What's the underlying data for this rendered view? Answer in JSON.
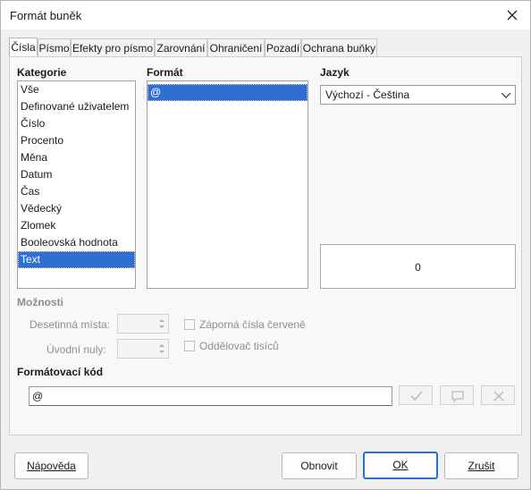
{
  "window": {
    "title": "Formát buněk"
  },
  "tabs": [
    {
      "label": "Čísla",
      "active": true
    },
    {
      "label": "Písmo"
    },
    {
      "label": "Efekty pro písmo"
    },
    {
      "label": "Zarovnání"
    },
    {
      "label": "Ohraničení"
    },
    {
      "label": "Pozadí"
    },
    {
      "label": "Ochrana buňky"
    }
  ],
  "category": {
    "label": "Kategorie",
    "items": [
      "Vše",
      "Definované uživatelem",
      "Číslo",
      "Procento",
      "Měna",
      "Datum",
      "Čas",
      "Vědecký",
      "Zlomek",
      "Booleovská hodnota",
      "Text"
    ],
    "selected": "Text"
  },
  "format": {
    "label": "Formát",
    "items": [
      "@"
    ],
    "selected": "@"
  },
  "language": {
    "label": "Jazyk",
    "value": "Výchozí - Čeština"
  },
  "preview": {
    "value": "0"
  },
  "options": {
    "label": "Možnosti",
    "decimal_places_label": "Desetinná místa:",
    "leading_zeros_label": "Úvodní nuly:",
    "negative_red_label": "Záporná čísla červeně",
    "thousands_sep_label": "Oddělovač tisíců"
  },
  "format_code": {
    "label": "Formátovací kód",
    "value": "@"
  },
  "buttons": {
    "help": "Nápověda",
    "reset": "Obnovit",
    "ok": "OK",
    "cancel": "Zrušit"
  }
}
